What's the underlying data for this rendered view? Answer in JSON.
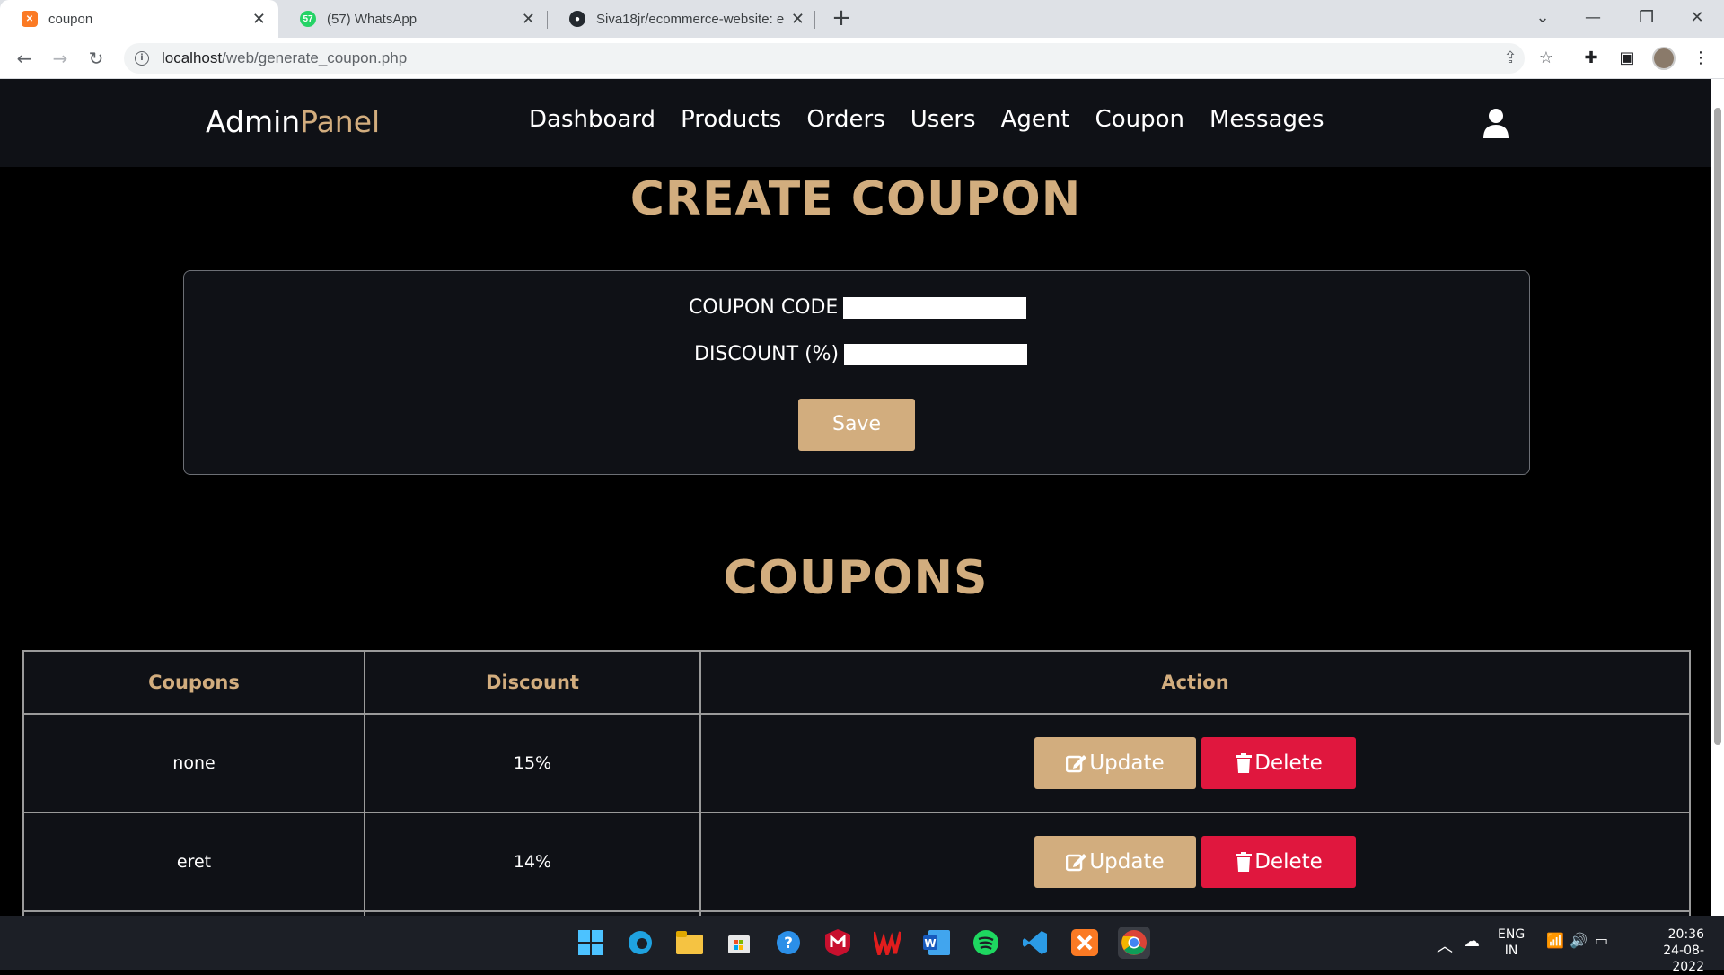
{
  "browser": {
    "tabs": [
      {
        "title": "coupon",
        "icon": "xampp-icon",
        "active": true
      },
      {
        "title": "(57) WhatsApp",
        "icon": "whatsapp-icon",
        "badge": "57",
        "active": false
      },
      {
        "title": "Siva18jr/ecommerce-website: e-c",
        "icon": "github-icon",
        "active": false
      }
    ],
    "url_host": "localhost",
    "url_path": "/web/generate_coupon.php"
  },
  "header": {
    "brand_main": "Admin",
    "brand_accent": "Panel",
    "nav": [
      "Dashboard",
      "Products",
      "Orders",
      "Users",
      "Agent",
      "Coupon",
      "Messages"
    ]
  },
  "create": {
    "title": "CREATE COUPON",
    "code_label": "COUPON CODE",
    "discount_label": "DISCOUNT (%)",
    "save_label": "Save"
  },
  "list": {
    "title": "COUPONS",
    "columns": [
      "Coupons",
      "Discount",
      "Action"
    ],
    "rows": [
      {
        "code": "none",
        "discount": "15%"
      },
      {
        "code": "eret",
        "discount": "14%"
      }
    ],
    "update_label": "Update",
    "delete_label": "Delete"
  },
  "taskbar": {
    "lang": "ENG",
    "region": "IN",
    "time": "20:36",
    "date": "24-08-2022"
  },
  "colors": {
    "accent": "#d2ad7e",
    "danger": "#e0173e",
    "panel": "#0f1116"
  }
}
